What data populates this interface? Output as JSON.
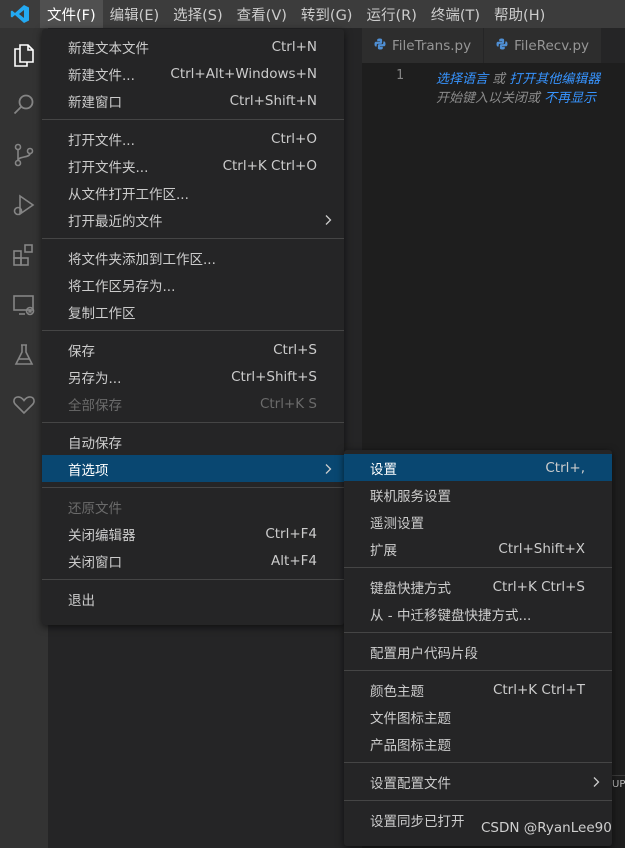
{
  "menubar": {
    "items": [
      "文件(F)",
      "编辑(E)",
      "选择(S)",
      "查看(V)",
      "转到(G)",
      "运行(R)",
      "终端(T)",
      "帮助(H)"
    ],
    "active_index": 0
  },
  "activity_icons": [
    "files-icon",
    "search-icon",
    "source-control-icon",
    "run-debug-icon",
    "extensions-icon",
    "remote-explorer-icon",
    "testing-icon",
    "heart-icon"
  ],
  "tabs": [
    {
      "label": "FileTrans.py"
    },
    {
      "label": "FileRecv.py"
    }
  ],
  "editor": {
    "line_number": "1",
    "line1": {
      "part1": "选择语言",
      "part2": " 或 ",
      "part3": "打开其他编辑器"
    },
    "line2": {
      "part1": "开始键入以关闭或 ",
      "part2": "不再显示"
    },
    "panel_text": "UP"
  },
  "file_menu": {
    "groups": [
      [
        {
          "label": "新建文本文件",
          "shortcut": "Ctrl+N"
        },
        {
          "label": "新建文件...",
          "shortcut": "Ctrl+Alt+Windows+N"
        },
        {
          "label": "新建窗口",
          "shortcut": "Ctrl+Shift+N"
        }
      ],
      [
        {
          "label": "打开文件...",
          "shortcut": "Ctrl+O"
        },
        {
          "label": "打开文件夹...",
          "shortcut": "Ctrl+K Ctrl+O"
        },
        {
          "label": "从文件打开工作区...",
          "shortcut": ""
        },
        {
          "label": "打开最近的文件",
          "shortcut": "",
          "submenu": true
        }
      ],
      [
        {
          "label": "将文件夹添加到工作区...",
          "shortcut": ""
        },
        {
          "label": "将工作区另存为...",
          "shortcut": ""
        },
        {
          "label": "复制工作区",
          "shortcut": ""
        }
      ],
      [
        {
          "label": "保存",
          "shortcut": "Ctrl+S"
        },
        {
          "label": "另存为...",
          "shortcut": "Ctrl+Shift+S"
        },
        {
          "label": "全部保存",
          "shortcut": "Ctrl+K S",
          "disabled": true
        }
      ],
      [
        {
          "label": "自动保存",
          "shortcut": ""
        },
        {
          "label": "首选项",
          "shortcut": "",
          "submenu": true,
          "selected": true
        }
      ],
      [
        {
          "label": "还原文件",
          "shortcut": "",
          "disabled": true
        },
        {
          "label": "关闭编辑器",
          "shortcut": "Ctrl+F4"
        },
        {
          "label": "关闭窗口",
          "shortcut": "Alt+F4"
        }
      ],
      [
        {
          "label": "退出",
          "shortcut": ""
        }
      ]
    ]
  },
  "preferences_menu": {
    "groups": [
      [
        {
          "label": "设置",
          "shortcut": "Ctrl+,",
          "selected": true
        },
        {
          "label": "联机服务设置",
          "shortcut": ""
        },
        {
          "label": "遥测设置",
          "shortcut": ""
        },
        {
          "label": "扩展",
          "shortcut": "Ctrl+Shift+X"
        }
      ],
      [
        {
          "label": "键盘快捷方式",
          "shortcut": "Ctrl+K Ctrl+S"
        },
        {
          "label": "从 - 中迁移键盘快捷方式...",
          "shortcut": ""
        }
      ],
      [
        {
          "label": "配置用户代码片段",
          "shortcut": ""
        }
      ],
      [
        {
          "label": "颜色主题",
          "shortcut": "Ctrl+K Ctrl+T"
        },
        {
          "label": "文件图标主题",
          "shortcut": ""
        },
        {
          "label": "产品图标主题",
          "shortcut": ""
        }
      ],
      [
        {
          "label": "设置配置文件",
          "shortcut": "",
          "submenu": true
        }
      ],
      [
        {
          "label": "设置同步已打开",
          "shortcut": ""
        }
      ]
    ]
  },
  "watermark": "CSDN @RyanLee90",
  "colors": {
    "menubar_bg": "#3c3c3c",
    "activitybar_bg": "#333333",
    "menu_bg": "#252526",
    "selection_bg": "#094771",
    "logo": "#23a9f2",
    "link": "#3794ff"
  }
}
